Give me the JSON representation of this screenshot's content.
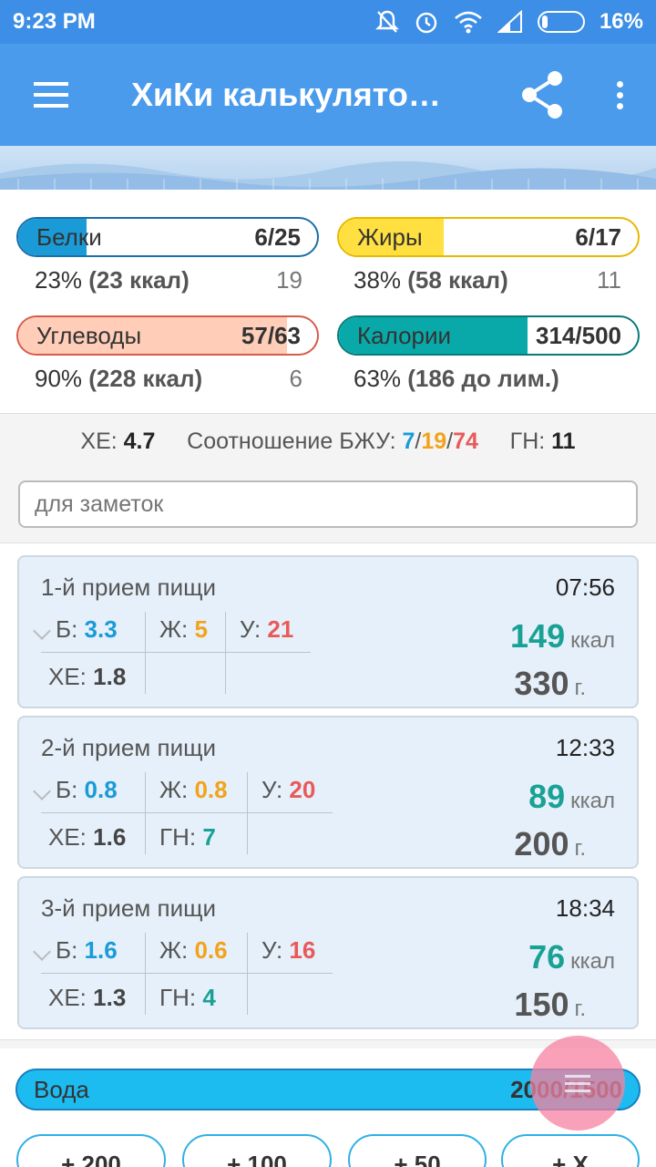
{
  "status_bar": {
    "time": "9:23 PM",
    "battery": "16%"
  },
  "app_bar": {
    "title": "ХиКи калькулято…"
  },
  "summary": {
    "protein": {
      "label": "Белки",
      "value": "6/25",
      "percent_line": "23% ",
      "kcal": "(23 ккал)",
      "remaining": "19",
      "fill": 0.23,
      "color": "#1a9bd7"
    },
    "fat": {
      "label": "Жиры",
      "value": "6/17",
      "percent_line": "38% ",
      "kcal": "(58 ккал)",
      "remaining": "11",
      "fill": 0.35,
      "color": "#ffe040"
    },
    "carbs": {
      "label": "Углеводы",
      "value": "57/63",
      "percent_line": "90% ",
      "kcal": "(228 ккал)",
      "remaining": "6",
      "fill": 0.9,
      "color": "#ffcdb8"
    },
    "calories": {
      "label": "Калории",
      "value": "314/500",
      "percent_line": "63% ",
      "kcal": "(186 до лим.)",
      "fill": 0.63,
      "color": "#0aa9a9"
    }
  },
  "stats": {
    "xe_label": "ХЕ:",
    "xe_value": "4.7",
    "ratio_label": "Соотношение БЖУ:",
    "ratio_p": "7",
    "ratio_f": "19",
    "ratio_c": "74",
    "sep": "/",
    "gn_label": "ГН:",
    "gn_value": "11"
  },
  "notes": {
    "placeholder": "для заметок"
  },
  "meals": [
    {
      "name": "1-й прием пищи",
      "time": "07:56",
      "p": "3.3",
      "f": "5",
      "c": "21",
      "xe": "1.8",
      "gn": "",
      "kcal": "149",
      "grams": "330"
    },
    {
      "name": "2-й прием пищи",
      "time": "12:33",
      "p": "0.8",
      "f": "0.8",
      "c": "20",
      "xe": "1.6",
      "gn": "7",
      "kcal": "89",
      "grams": "200"
    },
    {
      "name": "3-й прием пищи",
      "time": "18:34",
      "p": "1.6",
      "f": "0.6",
      "c": "16",
      "xe": "1.3",
      "gn": "4",
      "kcal": "76",
      "grams": "150"
    }
  ],
  "labels": {
    "p": "Б:",
    "f": "Ж:",
    "c": "У:",
    "xe": "ХЕ:",
    "gn": "ГН:",
    "kcal_unit": "ккал",
    "gram_unit": "г."
  },
  "water": {
    "label": "Вода",
    "value": "2000/1500"
  },
  "water_buttons": [
    "+ 200",
    "+ 100",
    "+ 50",
    "+ X"
  ]
}
